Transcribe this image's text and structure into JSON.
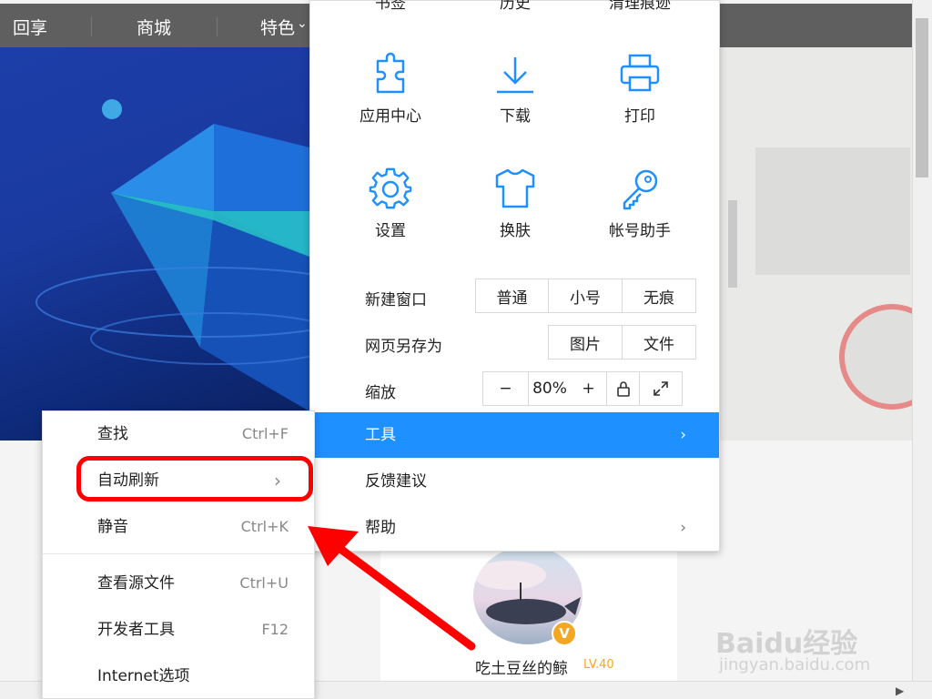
{
  "topnav": {
    "items": [
      "回享",
      "商城",
      "特色"
    ],
    "dropdown_glyph": "⌄"
  },
  "main_menu": {
    "top_partial": [
      "书签",
      "历史",
      "清理痕迹"
    ],
    "tiles_row1": [
      {
        "label": "应用中心",
        "icon": "puzzle-icon"
      },
      {
        "label": "下载",
        "icon": "download-icon"
      },
      {
        "label": "打印",
        "icon": "printer-icon"
      }
    ],
    "tiles_row2": [
      {
        "label": "设置",
        "icon": "gear-icon"
      },
      {
        "label": "换肤",
        "icon": "tshirt-icon"
      },
      {
        "label": "帐号助手",
        "icon": "key-icon"
      }
    ],
    "new_window": {
      "label": "新建窗口",
      "options": [
        "普通",
        "小号",
        "无痕"
      ]
    },
    "save_page": {
      "label": "网页另存为",
      "options": [
        "图片",
        "文件"
      ]
    },
    "zoom": {
      "label": "缩放",
      "minus": "−",
      "value": "80%",
      "plus": "+"
    },
    "tools": "工具",
    "feedback": "反馈建议",
    "help": "帮助",
    "chevron": "›"
  },
  "sub_menu": {
    "items": [
      {
        "label": "查找",
        "shortcut": "Ctrl+F"
      },
      {
        "label": "自动刷新",
        "shortcut": "›"
      },
      {
        "label": "静音",
        "shortcut": "Ctrl+K"
      },
      {
        "label": "查看源文件",
        "shortcut": "Ctrl+U"
      },
      {
        "label": "开发者工具",
        "shortcut": "F12"
      },
      {
        "label": "Internet选项",
        "shortcut": ""
      }
    ]
  },
  "profile": {
    "username": "吃土豆丝的鲸",
    "level": "LV.40",
    "badge": "V"
  },
  "watermark": {
    "brand": "Baidu经验",
    "url": "jingyan.baidu.com"
  },
  "colors": {
    "highlight": "#1e90ff",
    "annotation": "#ff0000",
    "icon_blue": "#1e90ff"
  }
}
